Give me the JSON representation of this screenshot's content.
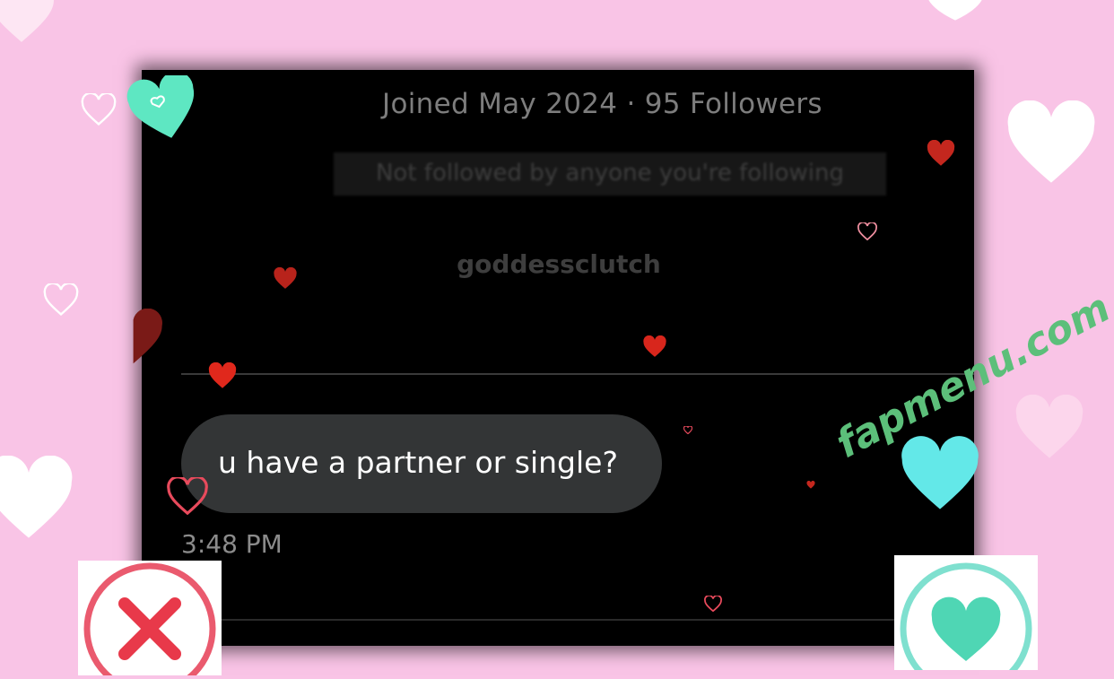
{
  "profile": {
    "joined_followers": "Joined May 2024 · 95 Followers",
    "not_followed": "Not followed by anyone you're following",
    "username": "goddessclutch"
  },
  "message": {
    "text": "u have a partner or single?",
    "time": "3:48 PM"
  },
  "watermark": "fapmenu.com",
  "colors": {
    "background": "#f9c4e6",
    "panel": "#000000",
    "bubble": "#333536",
    "reject": "#e85464",
    "like": "#5fdcc0",
    "heart_red": "#d8261c",
    "heart_cyan": "#63e8e8"
  },
  "icons": {
    "reject": "x-icon",
    "like": "heart-icon"
  }
}
